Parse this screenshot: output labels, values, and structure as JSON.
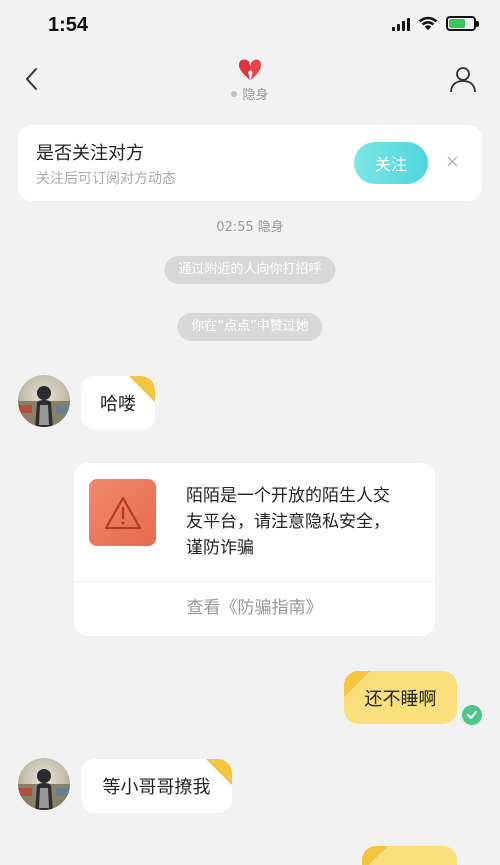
{
  "status_bar": {
    "time": "1:54"
  },
  "nav": {
    "presence": "隐身",
    "heart_icon": "broken-heart-icon",
    "back_icon": "chevron-left-icon",
    "profile_icon": "person-icon"
  },
  "follow_card": {
    "title": "是否关注对方",
    "subtitle": "关注后可订阅对方动态",
    "button": "关注",
    "close": "×"
  },
  "chat": {
    "timestamp": "02:55 隐身",
    "system_1": "通过附近的人向你打招呼",
    "system_2": "你在“点点”中赞过她",
    "msg_1": "哈喽",
    "warning_text": "陌陌是一个开放的陌生人交友平台，请注意隐私安全，谨防诈骗",
    "warning_link": "查看《防骗指南》",
    "msg_2": "还不睡啊",
    "msg_3": "等小哥哥撩我"
  },
  "colors": {
    "accent": "#4dd6dd",
    "outgoing_bubble": "#fae07c",
    "warning": "#e6694e",
    "read_check": "#4cc78a"
  }
}
